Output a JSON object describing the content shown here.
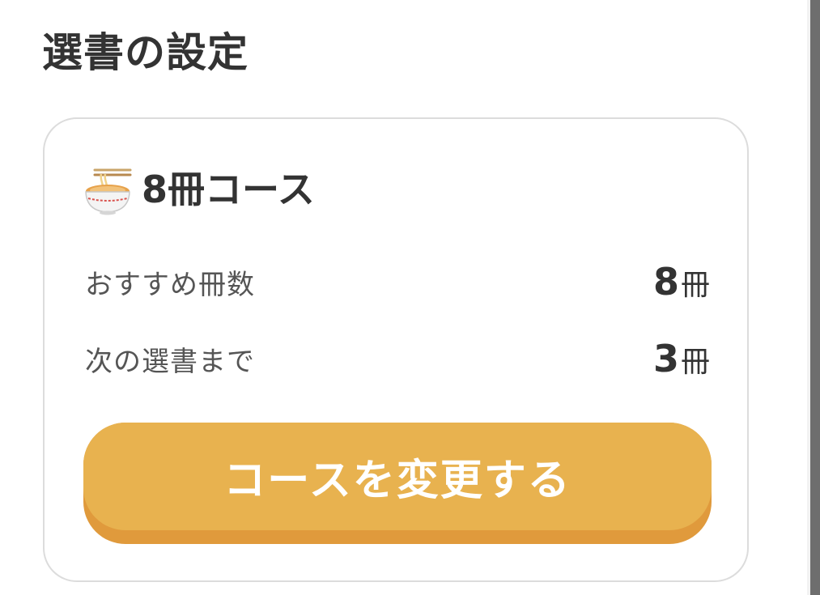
{
  "page": {
    "title": "選書の設定"
  },
  "course_card": {
    "icon": "ramen-bowl-icon",
    "title": "8冊コース",
    "rows": [
      {
        "label": "おすすめ冊数",
        "value": "8",
        "unit": "冊"
      },
      {
        "label": "次の選書まで",
        "value": "3",
        "unit": "冊"
      }
    ],
    "button_label": "コースを変更する"
  },
  "colors": {
    "button_face": "#e8b24f",
    "button_shadow": "#e09a3c",
    "text": "#333333",
    "card_border": "#dcdcdc"
  }
}
